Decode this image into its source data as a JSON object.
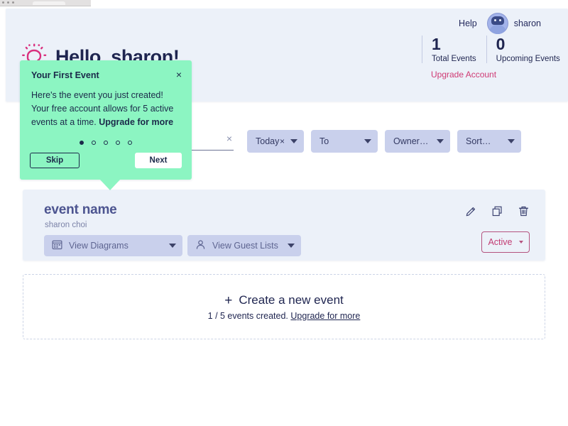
{
  "header": {
    "help_label": "Help",
    "user_name": "sharon",
    "greeting": "Hello, sharon!",
    "upgrade_account_label": "Upgrade Account",
    "stats": [
      {
        "value": "1",
        "label": "Total Events"
      },
      {
        "value": "0",
        "label": "Upcoming Events"
      }
    ]
  },
  "filters": {
    "search_value": "",
    "search_placeholder": "",
    "clear_label": "×",
    "chips": [
      {
        "label": "Today",
        "has_clear": true,
        "clear_label": "×"
      },
      {
        "label": "To",
        "has_clear": false,
        "clear_label": ""
      },
      {
        "label": "Owner…",
        "has_clear": false,
        "clear_label": ""
      },
      {
        "label": "Sort…",
        "has_clear": false,
        "clear_label": ""
      }
    ]
  },
  "event": {
    "name": "event name",
    "owner": "sharon choi",
    "diagrams_label": "View Diagrams",
    "guests_label": "View Guest Lists",
    "status_label": "Active",
    "status_color": "#c23b72"
  },
  "create": {
    "plus": "+",
    "title": "Create a new event",
    "count_text": "1 / 5 events created.",
    "upgrade_link": "Upgrade for more"
  },
  "tooltip": {
    "title": "Your First Event",
    "close_label": "×",
    "body_text": "Here's the event you just created! Your free account allows for 5 active events at a time. ",
    "body_bold": "Upgrade for more",
    "skip_label": "Skip",
    "next_label": "Next",
    "step_current": 1,
    "step_total": 5,
    "background_color": "#8cf5c2"
  },
  "theme": {
    "panel_bg": "#ecf1f9",
    "chip_bg": "#c9d0ec",
    "accent_pink": "#cf3a74",
    "text_dark": "#1f2550"
  }
}
